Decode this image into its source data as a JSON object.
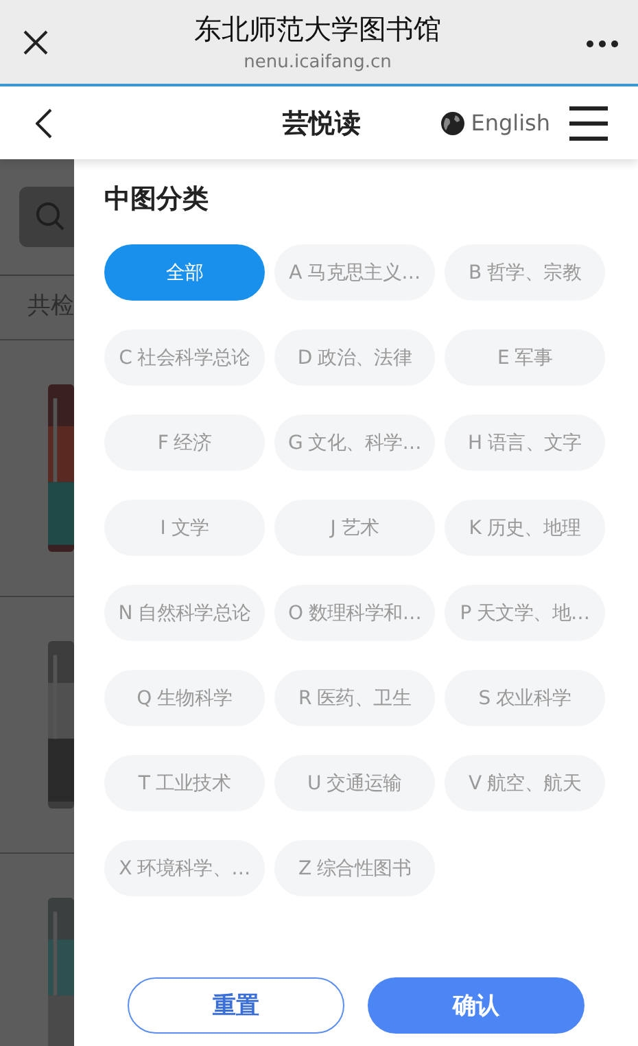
{
  "browser": {
    "title": "东北师范大学图书馆",
    "url": "nenu.icaifang.cn"
  },
  "app_bar": {
    "title": "芸悦读",
    "language": "English"
  },
  "background_page": {
    "result_text": "共检"
  },
  "filter": {
    "title": "中图分类",
    "categories": [
      {
        "label": "全部",
        "selected": true
      },
      {
        "label": "A 马克思主义…",
        "selected": false
      },
      {
        "label": "B 哲学、宗教",
        "selected": false
      },
      {
        "label": "C 社会科学总论",
        "selected": false
      },
      {
        "label": "D 政治、法律",
        "selected": false
      },
      {
        "label": "E 军事",
        "selected": false
      },
      {
        "label": "F 经济",
        "selected": false
      },
      {
        "label": "G 文化、科学…",
        "selected": false
      },
      {
        "label": "H 语言、文字",
        "selected": false
      },
      {
        "label": "I 文学",
        "selected": false
      },
      {
        "label": "J 艺术",
        "selected": false
      },
      {
        "label": "K 历史、地理",
        "selected": false
      },
      {
        "label": "N 自然科学总论",
        "selected": false
      },
      {
        "label": "O 数理科学和…",
        "selected": false
      },
      {
        "label": "P 天文学、地…",
        "selected": false
      },
      {
        "label": "Q 生物科学",
        "selected": false
      },
      {
        "label": "R 医药、卫生",
        "selected": false
      },
      {
        "label": "S 农业科学",
        "selected": false
      },
      {
        "label": "T 工业技术",
        "selected": false
      },
      {
        "label": "U 交通运输",
        "selected": false
      },
      {
        "label": "V 航空、航天",
        "selected": false
      },
      {
        "label": "X 环境科学、…",
        "selected": false
      },
      {
        "label": "Z 综合性图书",
        "selected": false
      }
    ],
    "buttons": [
      {
        "label": "重置",
        "kind": "outline"
      },
      {
        "label": "确认",
        "kind": "primary"
      }
    ]
  }
}
